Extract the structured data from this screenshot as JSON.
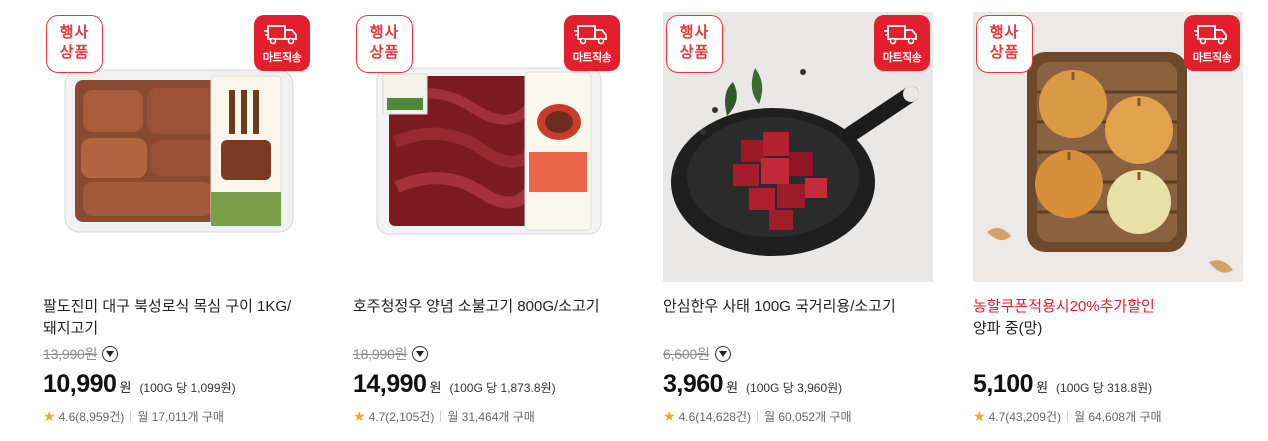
{
  "badges": {
    "event_line1": "행사",
    "event_line2": "상품",
    "mart": "마트직송"
  },
  "won": "원",
  "products": [
    {
      "promo": "",
      "title": "팔도진미 대구 북성로식 목심 구이 1KG/돼지고기",
      "original_price": "13,990원",
      "price": "10,990",
      "unit_price": "(100G 당 1,099원)",
      "rating": "4.6",
      "reviews": "(8,959건)",
      "purchases": "월 17,011개 구매",
      "image": "pork-neck-tray"
    },
    {
      "promo": "",
      "title": "호주청정우 양념 소불고기 800G/소고기",
      "original_price": "18,990원",
      "price": "14,990",
      "unit_price": "(100G 당 1,873.8원)",
      "rating": "4.7",
      "reviews": "(2,105건)",
      "purchases": "월 31,464개 구매",
      "image": "beef-bulgogi-tray"
    },
    {
      "promo": "",
      "title": "안심한우 사태 100G 국거리용/소고기",
      "original_price": "6,600원",
      "price": "3,960",
      "unit_price": "(100G 당 3,960원)",
      "rating": "4.6",
      "reviews": "(14,628건)",
      "purchases": "월 60,052개 구매",
      "image": "beef-cubes-pan"
    },
    {
      "promo": "농할쿠폰적용시20%추가할인",
      "title": "양파 중(망)",
      "original_price": "",
      "price": "5,100",
      "unit_price": "(100G 당 318.8원)",
      "rating": "4.7",
      "reviews": "(43,209건)",
      "purchases": "월 64,608개 구매",
      "image": "onions-basket"
    }
  ],
  "colors": {
    "accent": "#e31e2d",
    "star": "#f5a623",
    "muted": "#8c8c8c"
  }
}
